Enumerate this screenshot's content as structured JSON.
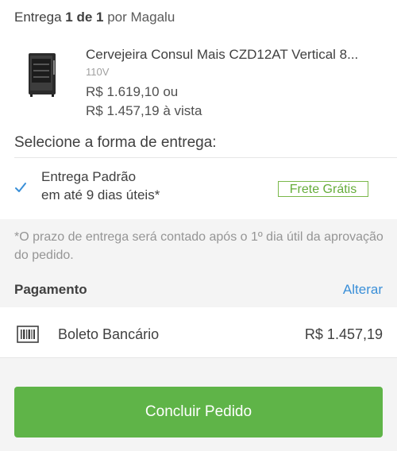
{
  "delivery": {
    "label_prefix": "Entrega",
    "label_count": "1 de 1",
    "label_suffix": "por Magalu"
  },
  "product": {
    "name": "Cervejeira Consul Mais CZD12AT Vertical 8...",
    "voltage": "110V",
    "price_installments": "R$ 1.619,10 ou",
    "price_cash": "R$ 1.457,19 à vista"
  },
  "shipping": {
    "section_title": "Selecione a forma de entrega:",
    "option_name": "Entrega Padrão",
    "option_eta": "em até 9 dias úteis*",
    "badge": "Frete Grátis",
    "note": "*O prazo de entrega será contado após o 1º dia útil da aprovação do pedido."
  },
  "payment": {
    "title": "Pagamento",
    "change_link": "Alterar",
    "method_name": "Boleto Bancário",
    "amount": "R$ 1.457,19"
  },
  "actions": {
    "conclude": "Concluir Pedido"
  },
  "colors": {
    "accent_blue": "#3a8fd8",
    "accent_green": "#5fb448"
  }
}
